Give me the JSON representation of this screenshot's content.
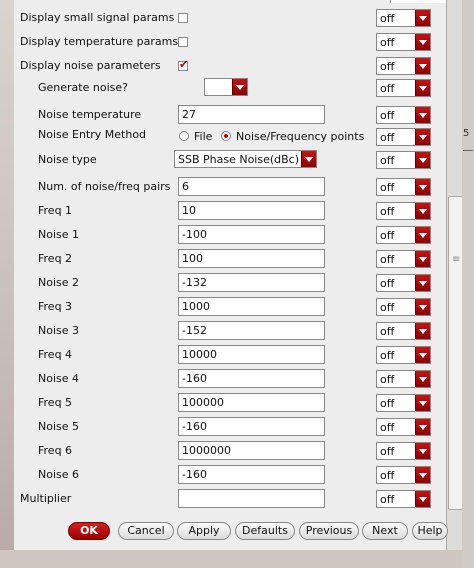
{
  "rows": [
    {
      "label": "Display small signal params",
      "control": "checkbox",
      "checked": false,
      "option": "off"
    },
    {
      "label": "Display temperature params",
      "control": "checkbox",
      "checked": false,
      "option": "off"
    },
    {
      "label": "Display noise parameters",
      "control": "checkbox",
      "checked": true,
      "option": "off"
    },
    {
      "label": "Generate noise?",
      "control": "select-empty",
      "option": "off"
    },
    {
      "label": "Noise temperature",
      "control": "text",
      "value": "27",
      "option": "off"
    },
    {
      "label": "Noise Entry Method",
      "control": "radio",
      "option": "off"
    },
    {
      "label": "Noise type",
      "control": "select",
      "value": "SSB Phase Noise(dBc)",
      "option": "off"
    },
    {
      "label": "Num. of noise/freq pairs",
      "control": "text",
      "value": "6",
      "option": "off"
    },
    {
      "label": "Freq 1",
      "control": "text",
      "value": "10",
      "option": "off"
    },
    {
      "label": "Noise 1",
      "control": "text",
      "value": "-100",
      "option": "off"
    },
    {
      "label": "Freq 2",
      "control": "text",
      "value": "100",
      "option": "off"
    },
    {
      "label": "Noise 2",
      "control": "text",
      "value": "-132",
      "option": "off"
    },
    {
      "label": "Freq 3",
      "control": "text",
      "value": "1000",
      "option": "off"
    },
    {
      "label": "Noise 3",
      "control": "text",
      "value": "-152",
      "option": "off"
    },
    {
      "label": "Freq 4",
      "control": "text",
      "value": "10000",
      "option": "off"
    },
    {
      "label": "Noise 4",
      "control": "text",
      "value": "-160",
      "option": "off"
    },
    {
      "label": "Freq 5",
      "control": "text",
      "value": "100000",
      "option": "off"
    },
    {
      "label": "Noise 5",
      "control": "text",
      "value": "-160",
      "option": "off"
    },
    {
      "label": "Freq 6",
      "control": "text",
      "value": "1000000",
      "option": "off"
    },
    {
      "label": "Noise 6",
      "control": "text",
      "value": "-160",
      "option": "off"
    },
    {
      "label": "Multiplier",
      "control": "text",
      "value": "",
      "option": "off"
    }
  ],
  "radio": {
    "options": [
      "File",
      "Noise/Frequency points"
    ],
    "selected": "Noise/Frequency points"
  },
  "buttons": {
    "ok": "OK",
    "cancel": "Cancel",
    "apply": "Apply",
    "defaults": "Defaults",
    "previous": "Previous",
    "next": "Next",
    "help": "Help"
  },
  "colors": {
    "accent": "#c00000",
    "panel": "#ededed"
  }
}
